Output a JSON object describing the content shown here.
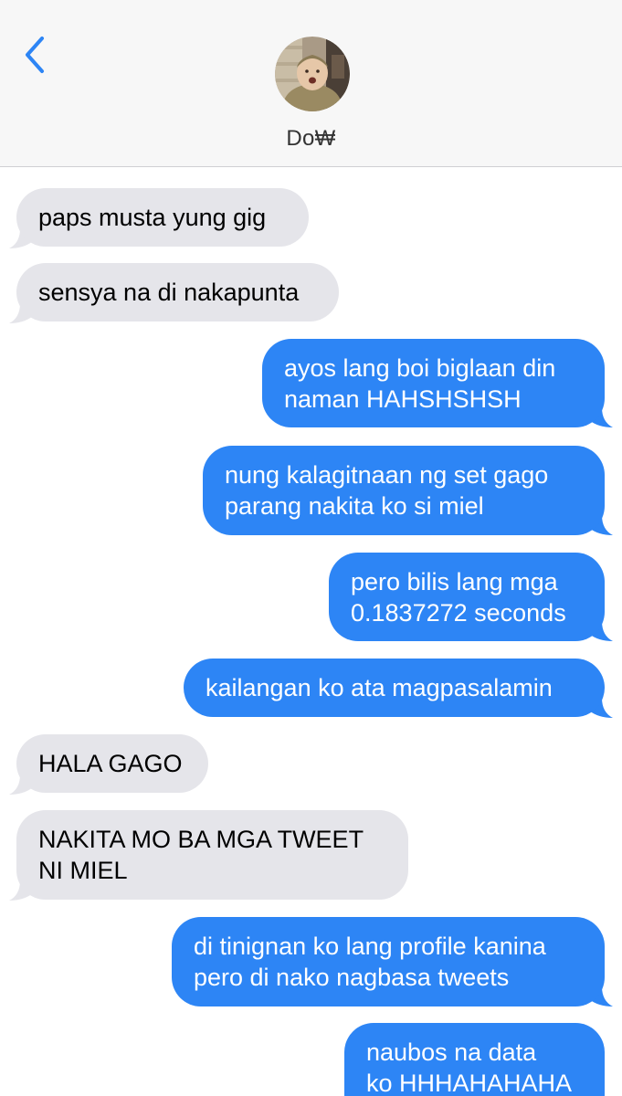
{
  "header": {
    "back_icon": "chevron-left-icon",
    "contact_name": "Do₩",
    "avatar_icon": "contact-photo"
  },
  "colors": {
    "incoming_bubble": "#e5e5ea",
    "outgoing_bubble": "#2d85f5",
    "accent": "#2d85f5"
  },
  "messages": [
    {
      "direction": "incoming",
      "text": "paps musta yung gig"
    },
    {
      "direction": "incoming",
      "text": "sensya na di nakapunta"
    },
    {
      "direction": "outgoing",
      "text": "ayos lang boi biglaan din\nnaman HAHSHSHSH"
    },
    {
      "direction": "outgoing",
      "text": "nung kalagitnaan ng set gago\nparang nakita ko si miel"
    },
    {
      "direction": "outgoing",
      "text": "pero bilis lang mga\n0.1837272 seconds"
    },
    {
      "direction": "outgoing",
      "text": "kailangan ko ata magpasalamin"
    },
    {
      "direction": "incoming",
      "text": "HALA GAGO"
    },
    {
      "direction": "incoming",
      "text": "NAKITA MO BA MGA TWEET\nNI MIEL"
    },
    {
      "direction": "outgoing",
      "text": "di tinignan ko lang profile kanina\npero di nako nagbasa tweets"
    },
    {
      "direction": "outgoing",
      "text": "naubos na data\nko HHHAHAHAHA"
    }
  ]
}
